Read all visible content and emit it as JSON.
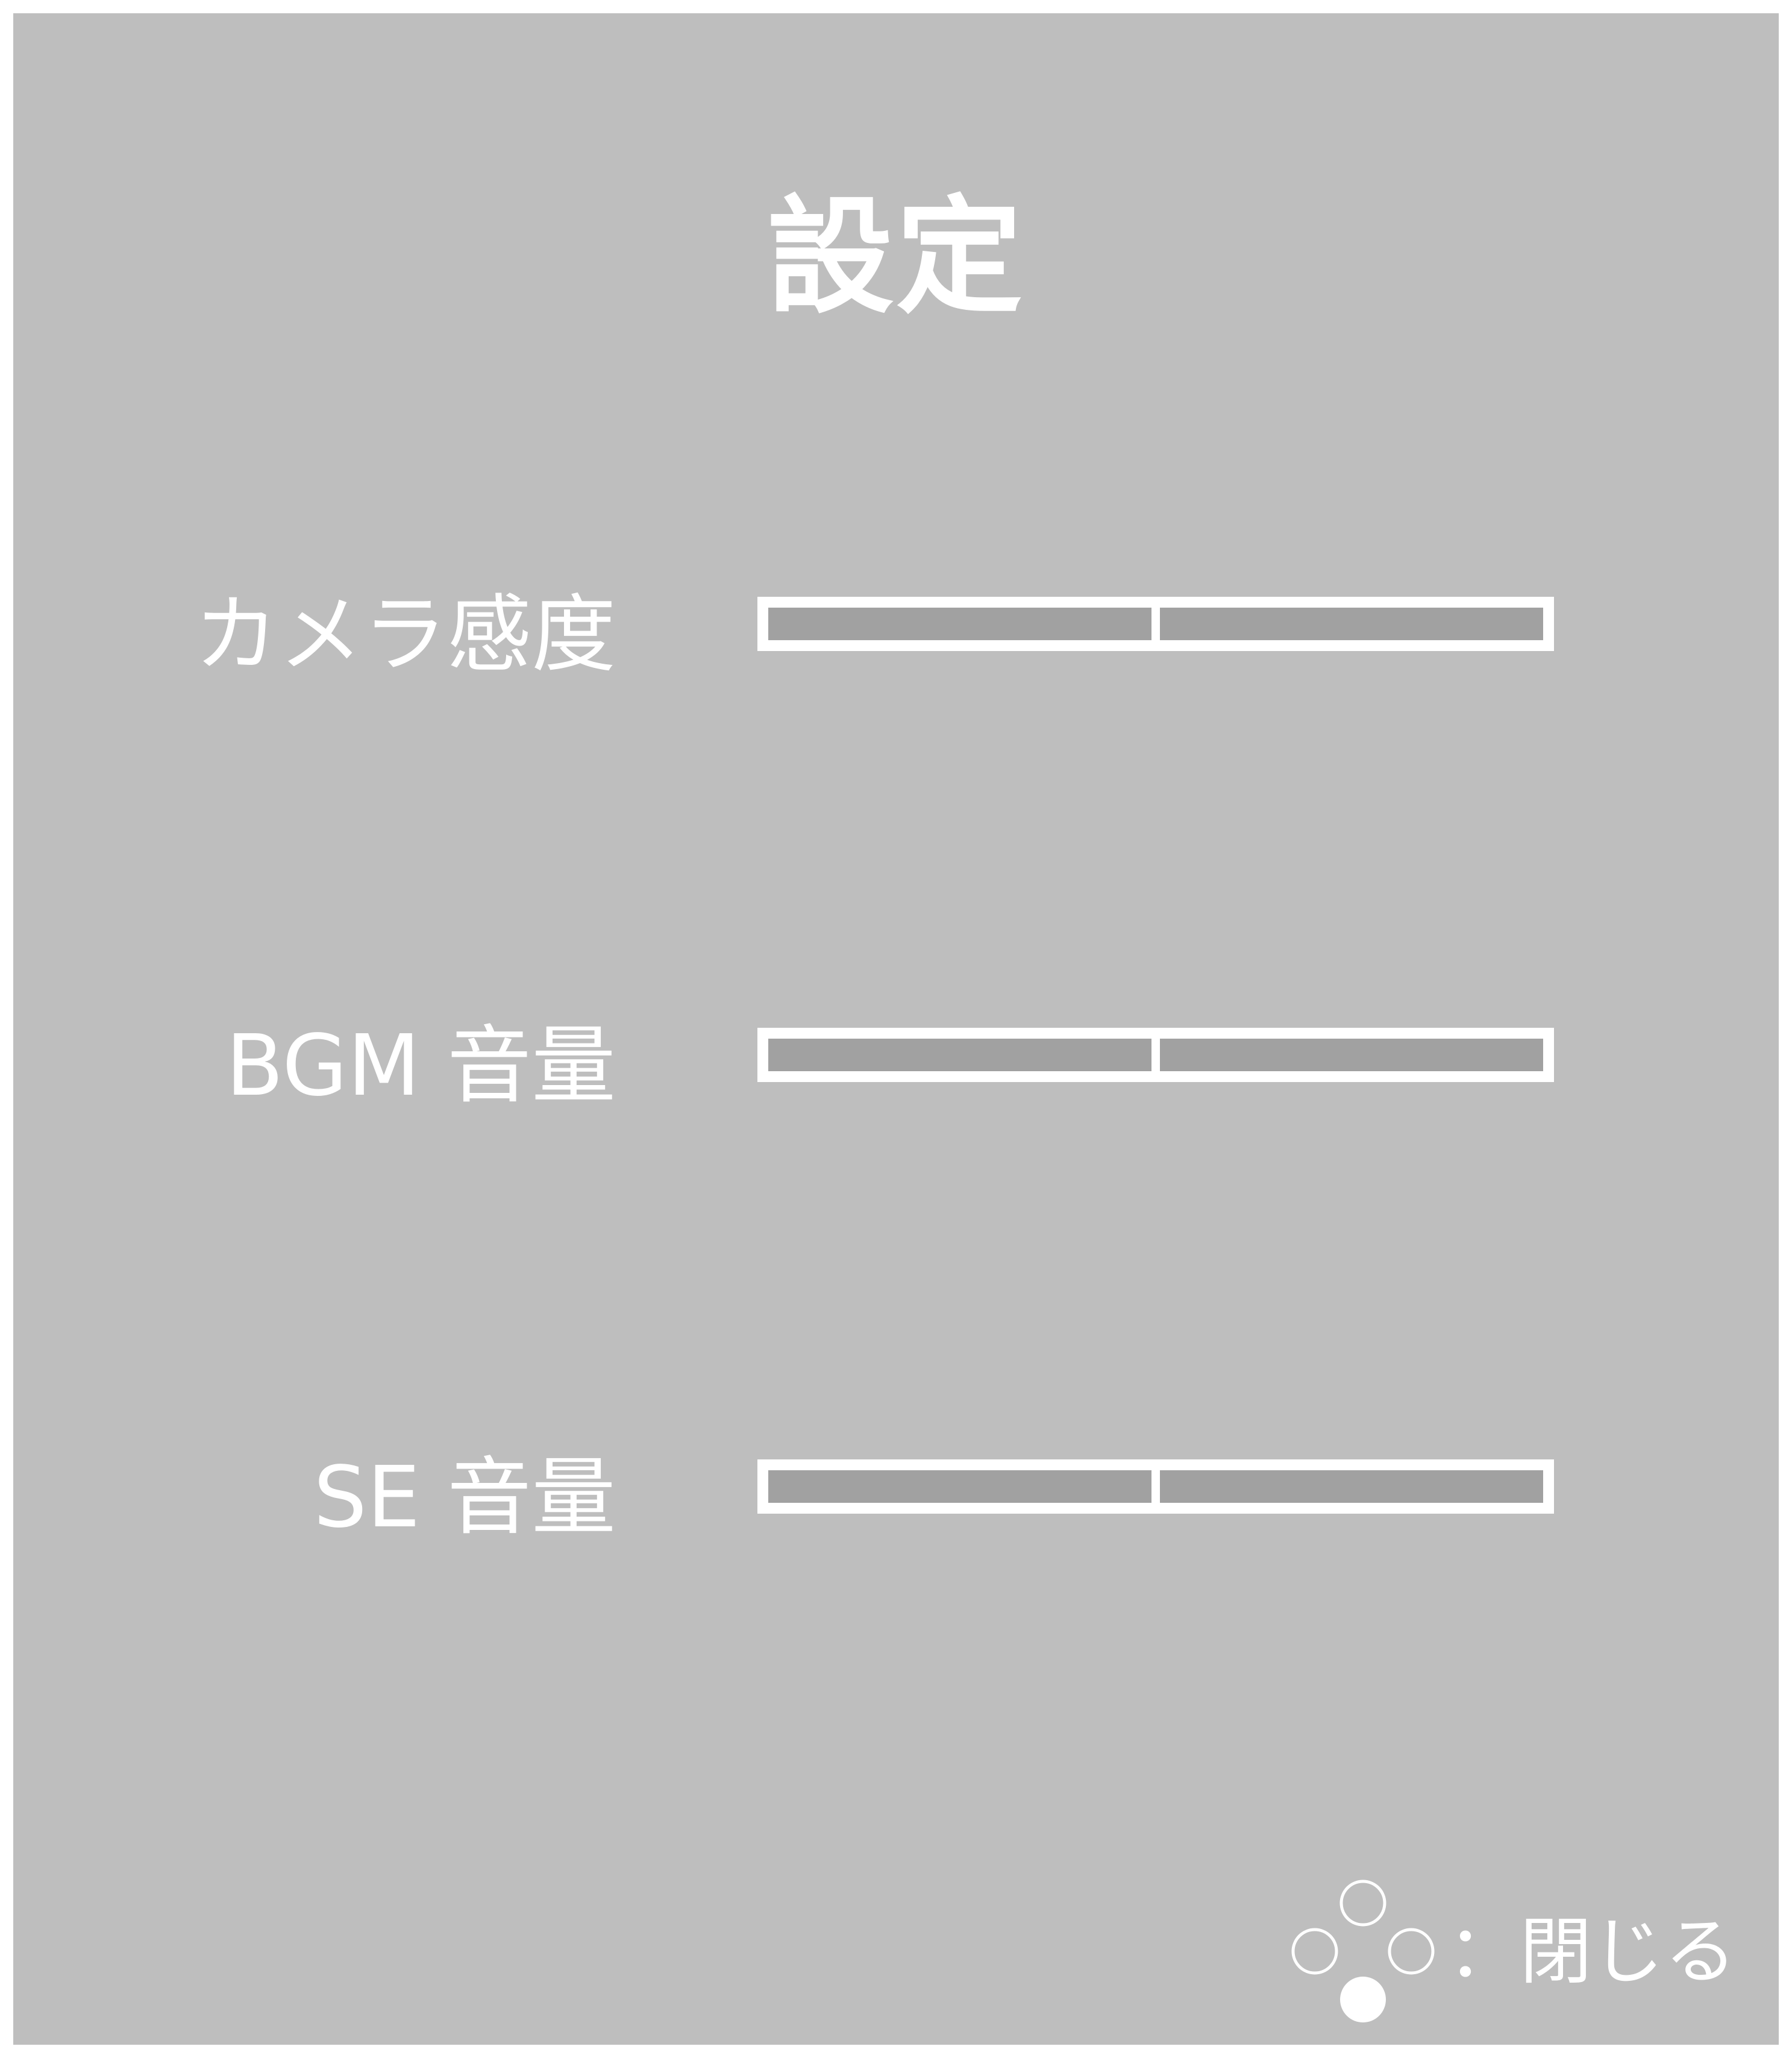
{
  "title": "設定",
  "settings": [
    {
      "label": "カメラ感度",
      "value": 0.5
    },
    {
      "label": "BGM 音量",
      "value": 0.5
    },
    {
      "label": "SE 音量",
      "value": 0.5
    }
  ],
  "close_hint": {
    "icon": "button-cluster-bottom-icon",
    "label": "：閉じる"
  },
  "colors": {
    "panel": "#bebebe",
    "track": "#a1a1a1",
    "foreground": "#ffffff"
  }
}
